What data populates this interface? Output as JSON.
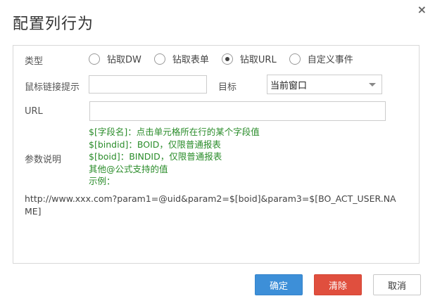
{
  "dialog": {
    "title": "配置列行为",
    "close_glyph": "×"
  },
  "form": {
    "type_label": "类型",
    "type_options": [
      {
        "label": "钻取DW",
        "checked": false
      },
      {
        "label": "钻取表单",
        "checked": false
      },
      {
        "label": "钻取URL",
        "checked": true
      },
      {
        "label": "自定义事件",
        "checked": false
      }
    ],
    "link_tip_label": "鼠标链接提示",
    "link_tip_value": "",
    "target_label": "目标",
    "target_value": "当前窗口",
    "url_label": "URL",
    "url_value": "",
    "params_label": "参数说明",
    "help_lines": [
      "$[字段名]：点击单元格所在行的某个字段值",
      "$[bindid]：BOID，仅限普通报表",
      "$[boid]：BINDID，仅限普通报表",
      "其他@公式支持的值",
      "示例："
    ],
    "example_url": "http://www.xxx.com?param1=@uid&param2=$[boid]&param3=$[BO_ACT_USER.NAME]"
  },
  "buttons": {
    "ok": "确定",
    "clear": "清除",
    "cancel": "取消"
  },
  "colors": {
    "ok_button": "#3d8fd8",
    "clear_button": "#e04f3e",
    "help_text": "#2a8c2a"
  }
}
